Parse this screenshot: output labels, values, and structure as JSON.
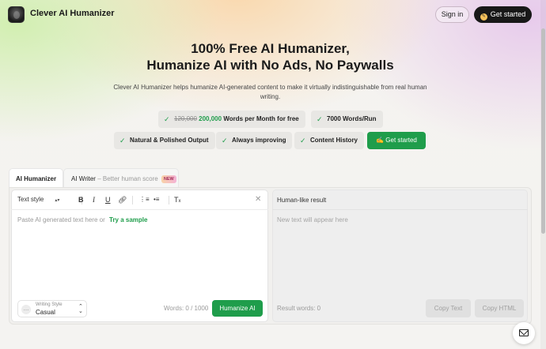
{
  "header": {
    "brand": "Clever AI Humanizer",
    "sign_in": "Sign in",
    "get_started": "Get started"
  },
  "hero": {
    "title_line1": "100% Free AI Humanizer,",
    "title_line2": "Humanize AI with No Ads, No Paywalls",
    "subtitle": "Clever AI Humanizer helps humanize AI-generated content to make it virtually indistinguishable from real human writing."
  },
  "features": {
    "words_old": "120,000",
    "words_new": "200,000",
    "words_suffix": "Words per Month for free",
    "per_run": "7000 Words/Run",
    "natural": "Natural & Polished Output",
    "improving": "Always improving",
    "history": "Content History",
    "get_started": "Get started"
  },
  "tabs": {
    "humanizer": "AI Humanizer",
    "writer": "AI Writer",
    "writer_note": "– Better human score",
    "new_badge": "NEW"
  },
  "editor": {
    "text_style": "Text style",
    "placeholder": "Paste AI generated text here or",
    "sample_link": "Try a sample",
    "writing_style_label": "Writing Style",
    "writing_style_value": "Casual",
    "word_count": "Words: 0 / 1000",
    "humanize_button": "Humanize AI"
  },
  "result": {
    "title": "Human-like result",
    "placeholder": "New text will appear here",
    "word_count": "Result words: 0",
    "copy_text": "Copy Text",
    "copy_html": "Copy HTML"
  },
  "icons": {
    "check": "check-icon",
    "bold": "bold-icon",
    "italic": "italic-icon",
    "underline": "underline-icon",
    "link": "link-icon",
    "ordered_list": "ordered-list-icon",
    "bullet_list": "bullet-list-icon",
    "clear_format": "clear-format-icon",
    "close": "close-icon",
    "mail": "mail-icon"
  },
  "colors": {
    "accent_green": "#1f9d4b",
    "dark_button": "#181818"
  }
}
